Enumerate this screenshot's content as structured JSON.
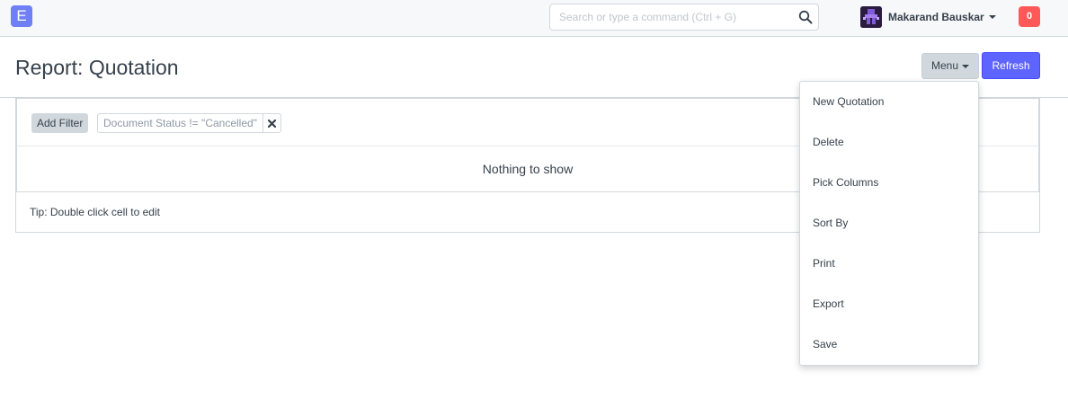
{
  "navbar": {
    "logo_letter": "E",
    "search_placeholder": "Search or type a command (Ctrl + G)",
    "user_name": "Makarand Bauskar",
    "notification_count": "0"
  },
  "page": {
    "title": "Report: Quotation",
    "menu_label": "Menu",
    "refresh_label": "Refresh"
  },
  "report": {
    "add_filter_label": "Add Filter",
    "filters": [
      "Document Status != \"Cancelled\""
    ],
    "empty_message": "Nothing to show",
    "tip": "Tip: Double click cell to edit"
  },
  "menu_items": [
    "New Quotation",
    "Delete",
    "Pick Columns",
    "Sort By",
    "Print",
    "Export",
    "Save"
  ],
  "colors": {
    "logo": "#6f7ff6",
    "refresh": "#5e64ff",
    "notification": "#ff5858",
    "menu_button": "#d1d8dd"
  }
}
